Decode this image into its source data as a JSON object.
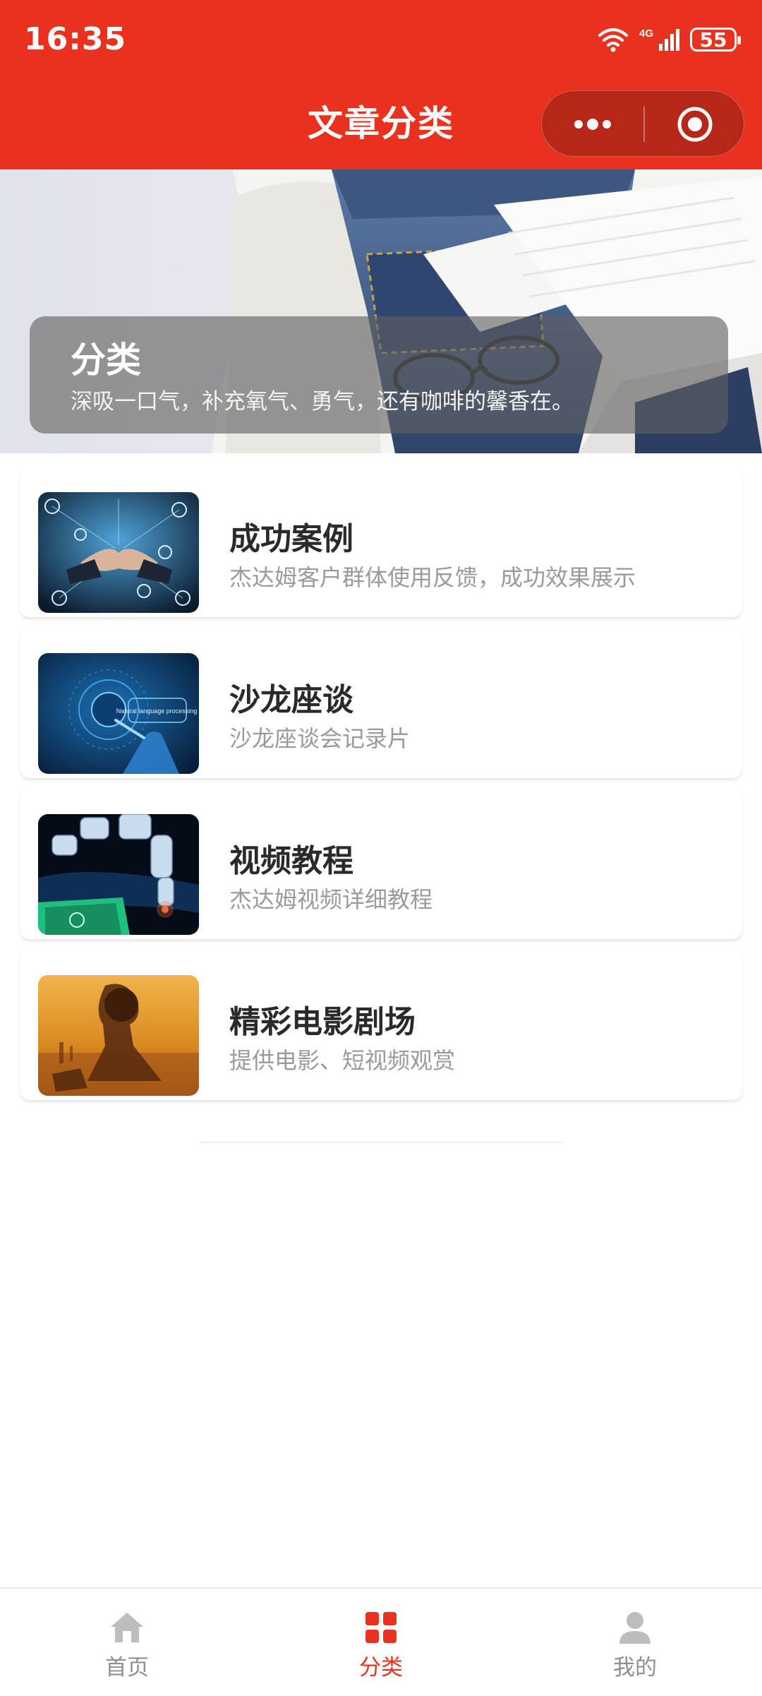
{
  "status_bar": {
    "time": "16:35",
    "network": "4G",
    "battery": "55"
  },
  "header": {
    "title": "文章分类"
  },
  "capsule": {
    "more_icon": "more-dots-icon",
    "close_icon": "target-icon"
  },
  "banner": {
    "title": "分类",
    "subtitle": "深吸一口气，补充氧气、勇气，还有咖啡的馨香在。"
  },
  "categories": [
    {
      "title": "成功案例",
      "description": "杰达姆客户群体使用反馈，成功效果展示"
    },
    {
      "title": "沙龙座谈",
      "description": "沙龙座谈会记录片",
      "thumb_text": "Natural language processing"
    },
    {
      "title": "视频教程",
      "description": "杰达姆视频详细教程"
    },
    {
      "title": "精彩电影剧场",
      "description": "提供电影、短视频观赏"
    }
  ],
  "tabs": [
    {
      "label": "首页",
      "icon": "home-icon",
      "active": false
    },
    {
      "label": "分类",
      "icon": "grid-icon",
      "active": true
    },
    {
      "label": "我的",
      "icon": "user-icon",
      "active": false
    }
  ],
  "colors": {
    "primary": "#e8321f",
    "text": "#2a2a2a",
    "muted": "#9a9a9a"
  }
}
